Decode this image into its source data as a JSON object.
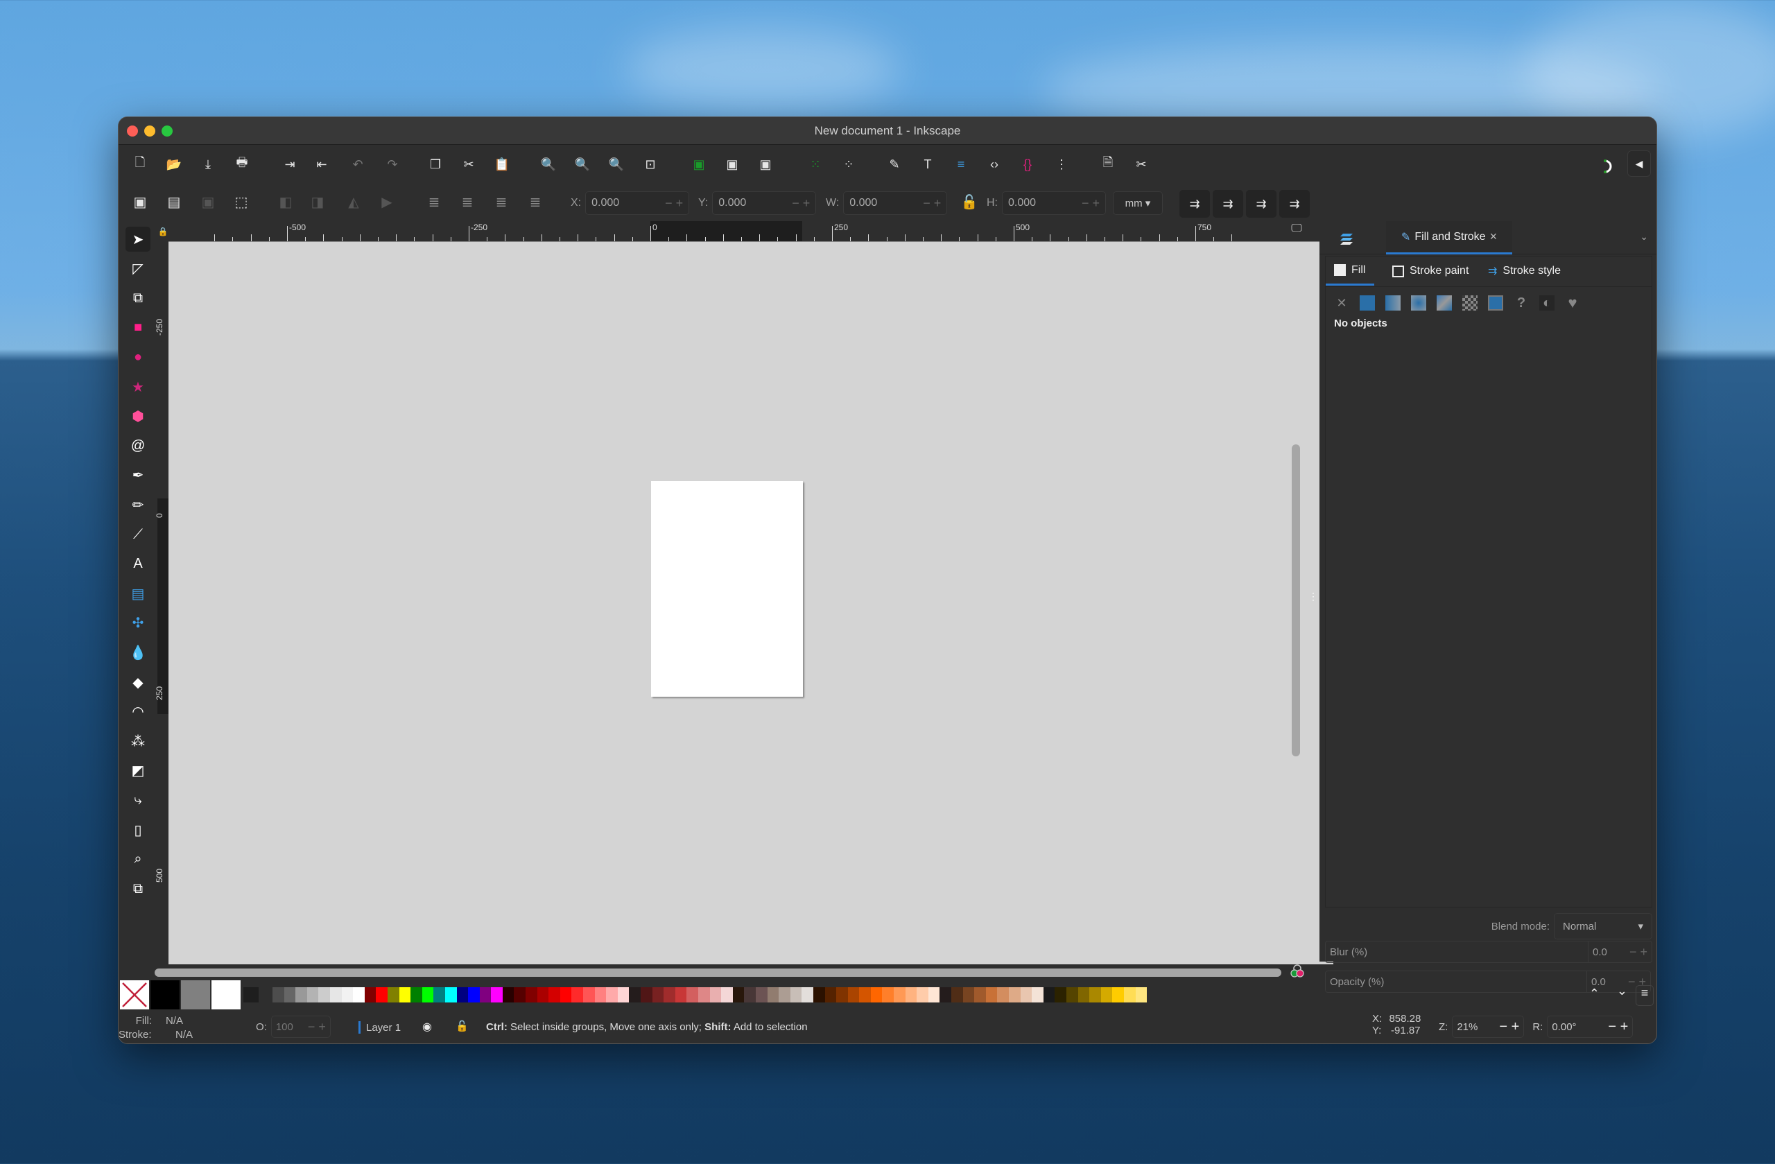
{
  "window": {
    "title": "New document 1 - Inkscape"
  },
  "toolbar_commands": [
    {
      "name": "new-document-icon",
      "glyph": "🗋"
    },
    {
      "name": "open-icon",
      "glyph": "📂"
    },
    {
      "name": "save-icon",
      "glyph": "⤓"
    },
    {
      "name": "print-icon",
      "glyph": "🖶"
    },
    {
      "name": "import-icon",
      "glyph": "⇥"
    },
    {
      "name": "export-icon",
      "glyph": "⇤"
    },
    {
      "name": "undo-icon",
      "glyph": "↶"
    },
    {
      "name": "redo-icon",
      "glyph": "↷"
    },
    {
      "name": "copy-icon",
      "glyph": "❐"
    },
    {
      "name": "cut-icon",
      "glyph": "✂"
    },
    {
      "name": "paste-icon",
      "glyph": "📋"
    },
    {
      "name": "zoom-selection-icon",
      "glyph": "🔍"
    },
    {
      "name": "zoom-drawing-icon",
      "glyph": "🔍"
    },
    {
      "name": "zoom-page-icon",
      "glyph": "🔍"
    },
    {
      "name": "zoom-center-icon",
      "glyph": "⊡"
    },
    {
      "name": "duplicate-icon",
      "glyph": "▣"
    },
    {
      "name": "clone-icon",
      "glyph": "▣"
    },
    {
      "name": "unlink-clone-icon",
      "glyph": "▣"
    },
    {
      "name": "group-icon",
      "glyph": "⁙"
    },
    {
      "name": "ungroup-icon",
      "glyph": "⁘"
    },
    {
      "name": "fill-stroke-icon",
      "glyph": "✎"
    },
    {
      "name": "text-font-icon",
      "glyph": "T"
    },
    {
      "name": "layers-objects-icon",
      "glyph": "≡"
    },
    {
      "name": "xml-editor-icon",
      "glyph": "‹›"
    },
    {
      "name": "selectors-css-icon",
      "glyph": "{}"
    },
    {
      "name": "align-distribute-icon",
      "glyph": "⋮"
    },
    {
      "name": "document-properties-icon",
      "glyph": "🗎"
    },
    {
      "name": "preferences-icon",
      "glyph": "✂"
    }
  ],
  "toolbar_right": {
    "snap_label": "snap-toggle",
    "collapse_label": "◀"
  },
  "select_toolbar": {
    "x_label": "X:",
    "x_value": "0.000",
    "y_label": "Y:",
    "y_value": "0.000",
    "w_label": "W:",
    "w_value": "0.000",
    "h_label": "H:",
    "h_value": "0.000",
    "unit": "mm",
    "minus": "−",
    "plus": "+"
  },
  "tools": [
    {
      "name": "selector-tool",
      "glyph": "➤",
      "color": "#ffffff"
    },
    {
      "name": "node-tool",
      "glyph": "◸",
      "color": "#ffffff"
    },
    {
      "name": "shape-builder-tool",
      "glyph": "⧉",
      "color": "#ffffff"
    },
    {
      "name": "rectangle-tool",
      "glyph": "■",
      "color": "#ff1f8a"
    },
    {
      "name": "ellipse-tool",
      "glyph": "●",
      "color": "#e0207e"
    },
    {
      "name": "star-polygon-tool",
      "glyph": "★",
      "color": "#d0267c"
    },
    {
      "name": "box-3d-tool",
      "glyph": "⬢",
      "color": "#ff4f9a"
    },
    {
      "name": "spiral-tool",
      "glyph": "@",
      "color": "#ffffff"
    },
    {
      "name": "pen-tool",
      "glyph": "✒",
      "color": "#ffffff"
    },
    {
      "name": "pencil-tool",
      "glyph": "✏",
      "color": "#ffffff"
    },
    {
      "name": "calligraphy-tool",
      "glyph": "⟋",
      "color": "#ffffff"
    },
    {
      "name": "text-tool",
      "glyph": "A",
      "color": "#ffffff"
    },
    {
      "name": "gradient-tool",
      "glyph": "▤",
      "color": "#3fa0e8"
    },
    {
      "name": "mesh-tool",
      "glyph": "✣",
      "color": "#3fa0e8"
    },
    {
      "name": "dropper-tool",
      "glyph": "💧",
      "color": "#ffffff"
    },
    {
      "name": "paint-bucket-tool",
      "glyph": "◆",
      "color": "#ffffff"
    },
    {
      "name": "tweak-tool",
      "glyph": "◠",
      "color": "#ffffff"
    },
    {
      "name": "spray-tool",
      "glyph": "⁂",
      "color": "#ffffff"
    },
    {
      "name": "eraser-tool",
      "glyph": "◩",
      "color": "#ffffff"
    },
    {
      "name": "connector-tool",
      "glyph": "⤷",
      "color": "#ffffff"
    },
    {
      "name": "pages-tool",
      "glyph": "▯",
      "color": "#ffffff"
    },
    {
      "name": "zoom-tool",
      "glyph": "⌕",
      "color": "#ffffff"
    },
    {
      "name": "measure-tool",
      "glyph": "⧉",
      "color": "#ffffff"
    }
  ],
  "rulers": {
    "horizontal": [
      "-500",
      "-250",
      "0",
      "250",
      "500",
      "750"
    ],
    "vertical": [
      "-250",
      "0",
      "250",
      "500"
    ]
  },
  "dock": {
    "tab_active": "Fill and Stroke",
    "close": "×",
    "subtabs": [
      "Fill",
      "Stroke paint",
      "Stroke style"
    ],
    "paint_types": [
      "no-paint",
      "flat-color",
      "linear-gradient",
      "radial-gradient",
      "mesh-gradient",
      "pattern",
      "swatch",
      "unset",
      "even-odd-fill",
      "nonzero-fill"
    ],
    "no_objects": "No objects",
    "blend_mode_label": "Blend mode:",
    "blend_mode_value": "Normal",
    "blur_label": "Blur (%)",
    "blur_value": "0.0",
    "opacity_label": "Opacity (%)",
    "opacity_value": "0.0"
  },
  "palette": {
    "fixed": [
      "#000000",
      "#808080",
      "#ffffff",
      "#1e1e1e"
    ],
    "colors": [
      "#4d4d4d",
      "#666666",
      "#999999",
      "#b3b3b3",
      "#cccccc",
      "#e6e6e6",
      "#f2f2f2",
      "#ffffff",
      "#800000",
      "#ff0000",
      "#808000",
      "#ffff00",
      "#008000",
      "#00ff00",
      "#008080",
      "#00ffff",
      "#000080",
      "#0000ff",
      "#800080",
      "#ff00ff",
      "#280000",
      "#550000",
      "#800000",
      "#aa0000",
      "#d40000",
      "#ff0000",
      "#ff2a2a",
      "#ff5555",
      "#ff8080",
      "#ffaaaa",
      "#ffd5d5",
      "#241c1c",
      "#501616",
      "#782121",
      "#a02c2c",
      "#c83737",
      "#d35f5f",
      "#de8787",
      "#e9afaf",
      "#f4d7d7",
      "#28170b",
      "#483737",
      "#6c5353",
      "#917c6f",
      "#ac9d93",
      "#c8beb7",
      "#e3dedb",
      "#2b1100",
      "#552200",
      "#803300",
      "#aa4400",
      "#d45500",
      "#ff6600",
      "#ff7f2a",
      "#ff9955",
      "#ffb380",
      "#ffccaa",
      "#ffe6d5",
      "#241c1c",
      "#502d16",
      "#784421",
      "#a05a2c",
      "#c87137",
      "#d38d5f",
      "#deaa87",
      "#e9c6af",
      "#f4e3d7",
      "#1a1a1a",
      "#2b2200",
      "#554400",
      "#806600",
      "#aa8800",
      "#d4aa00",
      "#ffcc00",
      "#ffdd55",
      "#ffe680"
    ],
    "scroll_up": "^",
    "scroll_down": "v",
    "menu": "≡"
  },
  "status": {
    "fill_label": "Fill:",
    "fill_value": "N/A",
    "stroke_label": "Stroke:",
    "stroke_value": "N/A",
    "opacity_label": "O:",
    "opacity_value": "100",
    "layer": "Layer 1",
    "message_ctrl": "Ctrl:",
    "message_mid": " Select inside groups, Move one axis only; ",
    "message_shift": "Shift:",
    "message_end": " Add to selection",
    "x_label": "X:",
    "x_value": "858.28",
    "y_label": "Y:",
    "y_value": "-91.87",
    "zoom_label": "Z:",
    "zoom_value": "21%",
    "rotate_label": "R:",
    "rotate_value": "0.00°"
  }
}
